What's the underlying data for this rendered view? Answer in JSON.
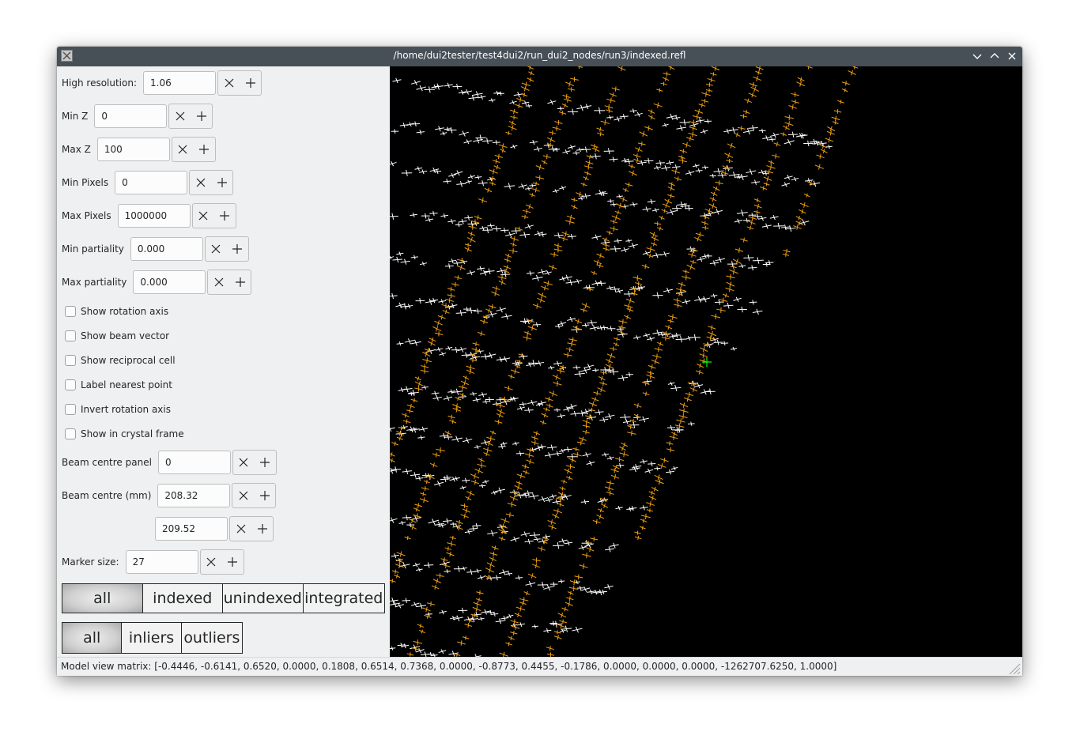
{
  "window": {
    "title": "/home/dui2tester/test4dui2/run_dui2_nodes/run3/indexed.refl",
    "icons": [
      "app-icon",
      "minimize-icon",
      "maximize-icon",
      "close-icon"
    ]
  },
  "fields": {
    "high_resolution": {
      "label": "High resolution:",
      "value": "1.06"
    },
    "min_z": {
      "label": "Min Z",
      "value": "0"
    },
    "max_z": {
      "label": "Max Z",
      "value": "100"
    },
    "min_pixels": {
      "label": "Min Pixels",
      "value": "0"
    },
    "max_pixels": {
      "label": "Max Pixels",
      "value": "1000000"
    },
    "min_partiality": {
      "label": "Min partiality",
      "value": "0.000"
    },
    "max_partiality": {
      "label": "Max partiality",
      "value": "0.000"
    },
    "beam_centre_panel": {
      "label": "Beam centre panel",
      "value": "0"
    },
    "beam_centre_mm": {
      "label": "Beam centre (mm)",
      "x": "208.32",
      "y": "209.52"
    },
    "marker_size": {
      "label": "Marker size:",
      "value": "27"
    }
  },
  "checkboxes": {
    "show_rotation_axis": {
      "label": "Show rotation axis",
      "checked": false
    },
    "show_beam_vector": {
      "label": "Show beam vector",
      "checked": false
    },
    "show_reciprocal_cell": {
      "label": "Show reciprocal cell",
      "checked": false
    },
    "label_nearest_point": {
      "label": "Label nearest point",
      "checked": false
    },
    "invert_rotation_axis": {
      "label": "Invert rotation axis",
      "checked": false
    },
    "show_in_crystal_frame": {
      "label": "Show in crystal frame",
      "checked": false
    }
  },
  "filter_indexed": {
    "options": [
      "all",
      "indexed",
      "unindexed",
      "integrated"
    ],
    "selected": "all"
  },
  "filter_outliers": {
    "options": [
      "all",
      "inliers",
      "outliers"
    ],
    "selected": "all"
  },
  "viewer": {
    "colors": {
      "background": "#000000",
      "unindexed": "#ffffff",
      "indexed": "#f0a010",
      "beam": "#00ff00"
    }
  },
  "status": {
    "text": "Model view matrix: [-0.4446, -0.6141, 0.6520, 0.0000, 0.1808, 0.6514, 0.7368, 0.0000, -0.8773, 0.4455, -0.1786, 0.0000, 0.0000, 0.0000, -1262707.6250, 1.0000]"
  }
}
